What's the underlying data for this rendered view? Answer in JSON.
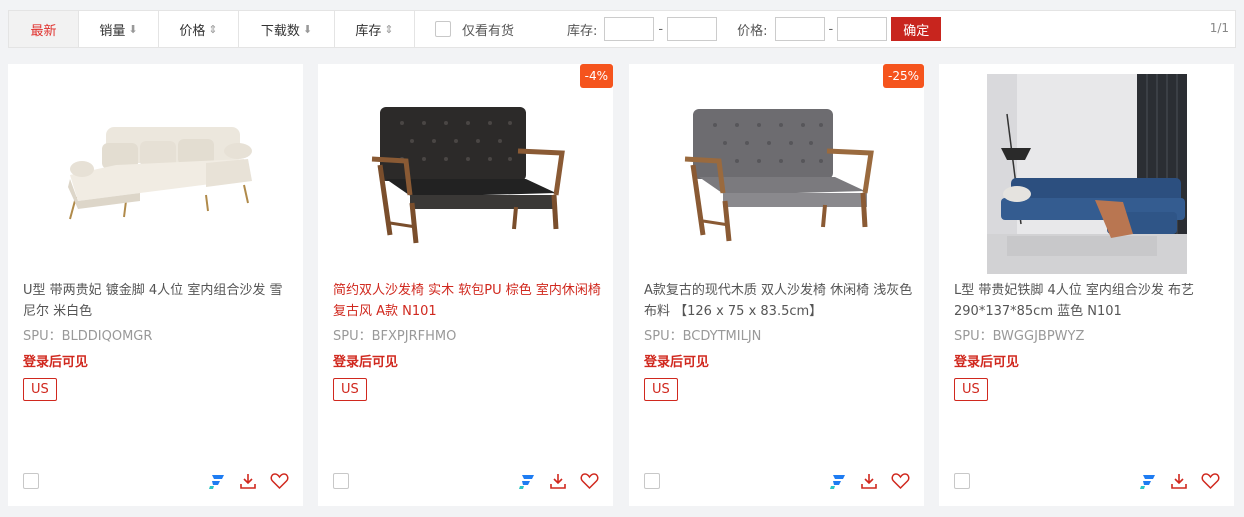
{
  "filters": {
    "sorts": [
      {
        "label": "最新",
        "arrow": ""
      },
      {
        "label": "销量",
        "arrow": "⬇"
      },
      {
        "label": "价格",
        "arrow": "⇕"
      },
      {
        "label": "下载数",
        "arrow": "⬇"
      },
      {
        "label": "库存",
        "arrow": "⇕"
      }
    ],
    "only_in_stock": "仅看有货",
    "stock_label": "库存:",
    "price_label": "价格:",
    "dash": "-",
    "confirm": "确定",
    "pager": "1/1"
  },
  "login_text": "登录后可见",
  "products": [
    {
      "title": "U型 带两贵妃 镀金脚 4人位 室内组合沙发 雪尼尔 米白色",
      "spu": "SPU：BLDDIQOMGR",
      "tag": "US",
      "discount": "",
      "image": "cream u-shaped sectional sofa"
    },
    {
      "title": "简约双人沙发椅 实木 软包PU 棕色 室内休闲椅 复古风 A款 N101",
      "spu": "SPU：BFXPJRFHMO",
      "tag": "US",
      "discount": "-4%",
      "image": "dark brown leather loveseat wood frame"
    },
    {
      "title": "A款复古的现代木质 双人沙发椅 休闲椅 浅灰色布料 【126 x 75 x 83.5cm】",
      "spu": "SPU：BCDYTMILJN",
      "tag": "US",
      "discount": "-25%",
      "image": "grey fabric loveseat wood frame"
    },
    {
      "title": "L型 带贵妃铁脚 4人位 室内组合沙发 布艺 290*137*85cm 蓝色 N101",
      "spu": "SPU：BWGGJBPWYZ",
      "tag": "US",
      "discount": "",
      "image": "blue L-shaped sofa in living room"
    }
  ],
  "colors": {
    "accent": "#d0281e",
    "badge": "#f5541d",
    "confirm": "#c8251e"
  },
  "icons": [
    "logo-f-icon",
    "download-icon",
    "heart-icon"
  ]
}
